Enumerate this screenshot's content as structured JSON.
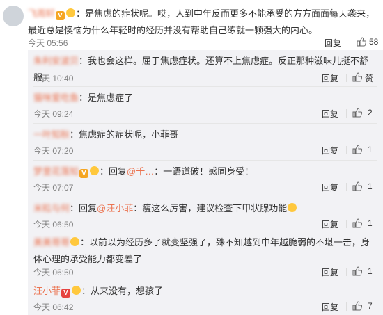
{
  "top": {
    "user": "飞雨轩",
    "text": "：是焦虑的症状呢。哎，人到中年反而更多不能承受的方方面面每天袭来，最近总是懊恼为什么年轻时的经历并没有帮助自己练就一颗强大的内心。",
    "time": "今天 05:56",
    "reply_label": "回复",
    "likes": "58"
  },
  "replies": [
    {
      "user": "朱利安波贝",
      "text": "：我也会这样。屈于焦虑症状。还算不上焦虑症。反正那种滋味儿挺不舒服。",
      "time": "今天 10:40",
      "reply_label": "回复",
      "likes": "赞"
    },
    {
      "user": "猫咪爱吃鱼",
      "text": "：是焦虑症了",
      "time": "今天 09:24",
      "reply_label": "回复",
      "likes": "2"
    },
    {
      "user": "一叶知秋",
      "text": "：焦虑症的症状呢，小菲哥",
      "time": "今天 07:20",
      "reply_label": "回复",
      "likes": "1"
    },
    {
      "user": "梦里花落知",
      "reply_word": "：回复",
      "mention": "@千…",
      "text": "：一语道破！感同身受！",
      "time": "今天 07:07",
      "reply_label": "回复",
      "likes": "1"
    },
    {
      "user": "米粒与何",
      "reply_word": "：回复",
      "mention": "@汪小菲",
      "text": "：瘦这么厉害，建议检查下甲状腺功能",
      "time": "今天 06:50",
      "reply_label": "回复",
      "likes": "1"
    },
    {
      "user": "美美哥哥",
      "text": "：以前以为经历多了就变坚强了，殊不知越到中年越脆弱的不堪一击，身体心理的承受能力都变差了",
      "time": "今天 06:50",
      "reply_label": "回复",
      "likes": "1"
    },
    {
      "user": "汪小菲",
      "text": "：从来没有，想孩子",
      "time": "今天 06:42",
      "reply_label": "回复",
      "likes": "7"
    }
  ]
}
